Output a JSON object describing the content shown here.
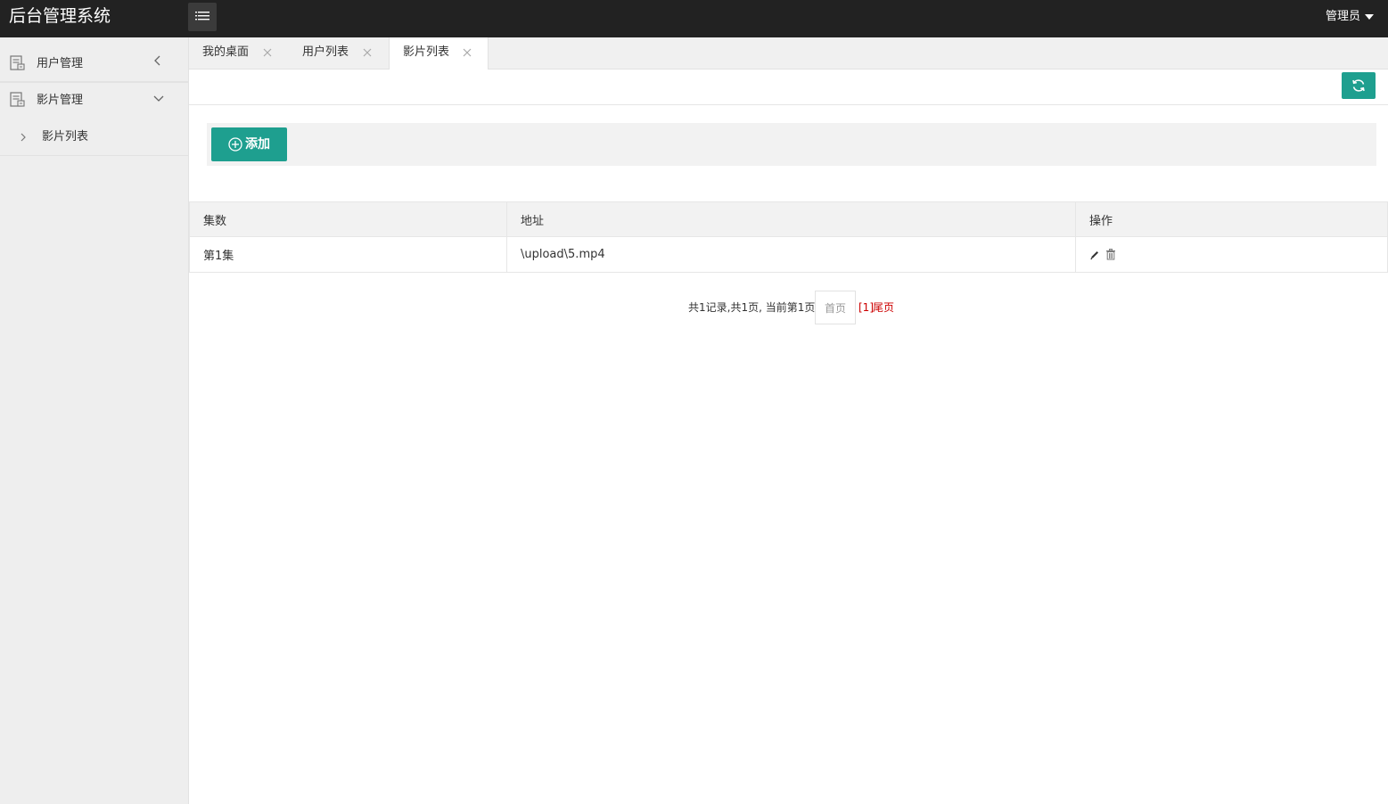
{
  "header": {
    "app_title": "后台管理系统",
    "menu_toggle_icon": "list-icon",
    "user_label": "管理员"
  },
  "sidebar": {
    "items": [
      {
        "label": "用户管理",
        "icon": "document-icon",
        "arrow": "chevron-left-icon",
        "expanded": false
      },
      {
        "label": "影片管理",
        "icon": "document-icon",
        "arrow": "chevron-down-icon",
        "expanded": true,
        "children": [
          {
            "label": "影片列表",
            "arrow": "chevron-right-icon"
          }
        ]
      }
    ]
  },
  "tabs": [
    {
      "label": "我的桌面",
      "active": false
    },
    {
      "label": "用户列表",
      "active": false
    },
    {
      "label": "影片列表",
      "active": true
    }
  ],
  "toolbar": {
    "refresh_icon": "refresh-icon"
  },
  "actions": {
    "add_label": "添加",
    "add_icon": "plus-circle-icon"
  },
  "table": {
    "headers": [
      "集数",
      "地址",
      "操作"
    ],
    "rows": [
      {
        "episode": "第1集",
        "address": "\\upload\\5.mp4",
        "ops": [
          "edit-icon",
          "delete-icon"
        ]
      }
    ]
  },
  "pagination": {
    "summary": "共1记录,共1页, 当前第1页",
    "first": "首页",
    "current": "[1]",
    "last": "尾页"
  },
  "colors": {
    "topbar": "#222222",
    "accent": "#1e9f8f",
    "sidebar_bg": "#eeeeee",
    "pager_link": "#cc0000"
  }
}
